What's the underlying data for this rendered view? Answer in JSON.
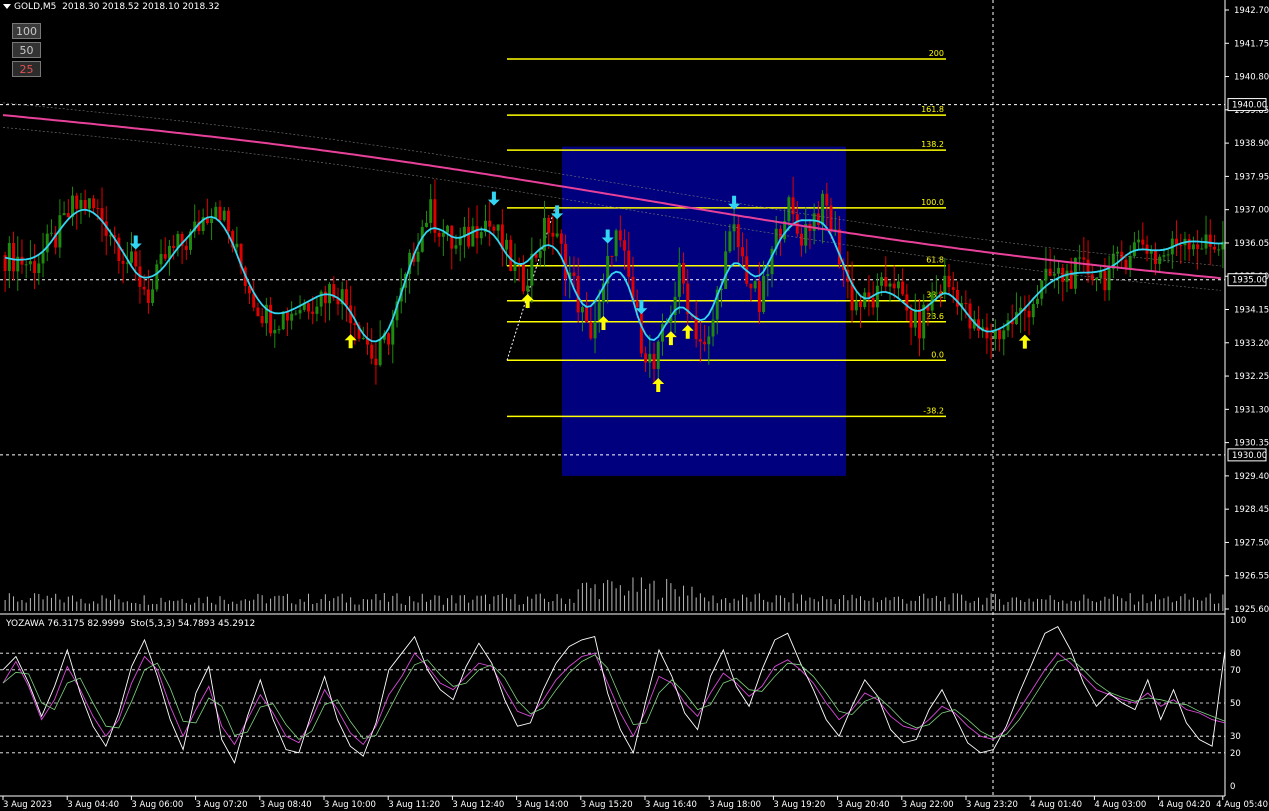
{
  "header": {
    "symbol": "GOLD,M5",
    "ohlc": "2018.30 2018.52 2018.10 2018.32",
    "buttons": [
      "100",
      "50",
      "25"
    ]
  },
  "indicator": {
    "label": "YOZAWA 76.3175 82.9999",
    "stoch_label": "Sto(5,3,3) 54.7893 45.2912"
  },
  "colors": {
    "background": "#000000",
    "bull": "#1f8a0e",
    "bear": "#e00000",
    "ma_fast": "#33d6f2",
    "ma_slow": "#e8419a",
    "fib": "#ffff00",
    "zone": "#00007f",
    "arrow_up": "#ffff00",
    "arrow_down": "#33d6f2"
  },
  "chart_data": [
    {
      "type": "candlestick",
      "title": "",
      "ylim": [
        1925.6,
        1942.7
      ],
      "y_ticks": [
        "1942.70",
        "1941.75",
        "1940.80",
        "1939.85",
        "1938.90",
        "1937.95",
        "1937.00",
        "1936.05",
        "1935.10",
        "1934.15",
        "1933.20",
        "1932.25",
        "1931.30",
        "1930.35",
        "1929.40",
        "1928.45",
        "1927.50",
        "1926.55",
        "1925.60"
      ],
      "x_labels": [
        "3 Aug 2023",
        "3 Aug 04:40",
        "3 Aug 06:00",
        "3 Aug 07:20",
        "3 Aug 08:40",
        "3 Aug 10:00",
        "3 Aug 11:20",
        "3 Aug 12:40",
        "3 Aug 14:00",
        "3 Aug 15:20",
        "3 Aug 16:40",
        "3 Aug 18:00",
        "3 Aug 19:20",
        "3 Aug 20:40",
        "3 Aug 22:00",
        "3 Aug 23:20",
        "4 Aug 01:40",
        "4 Aug 03:00",
        "4 Aug 04:20",
        "4 Aug 05:40"
      ],
      "highlighted_levels": [
        "1940.00",
        "1935.00",
        "1930.00"
      ],
      "closes": [
        1935.7,
        1935.6,
        1935.4,
        1935.8,
        1936.3,
        1937.0,
        1937.2,
        1936.9,
        1936.4,
        1935.7,
        1935.1,
        1934.5,
        1935.6,
        1935.9,
        1936.2,
        1936.8,
        1937.3,
        1936.2,
        1935.2,
        1934.3,
        1933.9,
        1934.0,
        1934.2,
        1934.4,
        1934.6,
        1934.8,
        1934.2,
        1933.5,
        1932.6,
        1933.5,
        1934.6,
        1936.0,
        1937.0,
        1936.4,
        1935.9,
        1936.2,
        1936.8,
        1936.4,
        1935.6,
        1934.9,
        1935.7,
        1936.6,
        1935.8,
        1934.8,
        1933.4,
        1934.2,
        1936.4,
        1935.2,
        1933.4,
        1932.4,
        1933.8,
        1935.2,
        1933.8,
        1932.8,
        1935.0,
        1936.4,
        1935.2,
        1934.2,
        1935.8,
        1937.2,
        1936.2,
        1936.8,
        1937.1,
        1935.8,
        1934.4,
        1934.3,
        1934.5,
        1935.2,
        1934.1,
        1933.6,
        1934.5,
        1934.9,
        1934.6,
        1933.6,
        1933.4,
        1933.5,
        1933.8,
        1934.1,
        1934.6,
        1935.1,
        1935.1,
        1935.2,
        1935.3,
        1935.1,
        1935.4,
        1935.9,
        1936.1,
        1935.6,
        1935.8,
        1936.3,
        1936.1,
        1935.9,
        1936.2
      ],
      "fib_levels": [
        {
          "label": "200",
          "value": 1941.3
        },
        {
          "label": "161.8",
          "value": 1939.7
        },
        {
          "label": "138.2",
          "value": 1938.7
        },
        {
          "label": "100.0",
          "value": 1937.05
        },
        {
          "label": "61.8",
          "value": 1935.4
        },
        {
          "label": "38.2",
          "value": 1934.4
        },
        {
          "label": "23.6",
          "value": 1933.8
        },
        {
          "label": "0.0",
          "value": 1932.7
        },
        {
          "label": "-38.2",
          "value": 1931.1
        }
      ],
      "zone": {
        "from": "3 Aug 14:40",
        "to": "3 Aug 20:00",
        "high": 1938.8,
        "low": 1929.4
      },
      "volume_axis": "volume histogram without scale"
    },
    {
      "type": "line",
      "title": "YOZAWA 76.3175 82.9999 Sto(5,3,3) 54.7893 45.2912",
      "ylim": [
        0,
        100
      ],
      "y_ticks": [
        "100",
        "80",
        "70",
        "50",
        "30",
        "20",
        "0"
      ],
      "reference_levels": [
        80,
        70,
        50,
        30,
        20
      ],
      "series": [
        {
          "name": "Sto(5,3,3)",
          "values": [
            62,
            75,
            60,
            40,
            52,
            72,
            58,
            42,
            30,
            40,
            62,
            78,
            70,
            48,
            30,
            46,
            60,
            36,
            25,
            40,
            55,
            44,
            30,
            26,
            40,
            58,
            46,
            32,
            25,
            36,
            55,
            66,
            80,
            72,
            62,
            58,
            66,
            74,
            72,
            58,
            45,
            42,
            52,
            64,
            72,
            78,
            80,
            62,
            44,
            30,
            46,
            66,
            62,
            50,
            42,
            56,
            68,
            62,
            54,
            60,
            72,
            76,
            70,
            62,
            50,
            40,
            46,
            56,
            52,
            42,
            36,
            34,
            40,
            48,
            44,
            36,
            30,
            28,
            34,
            46,
            58,
            70,
            80,
            74,
            66,
            58,
            55,
            52,
            50,
            56,
            48,
            52,
            46,
            44,
            40,
            38
          ]
        },
        {
          "name": "YOZAWA",
          "values": [
            70,
            78,
            62,
            42,
            60,
            82,
            56,
            36,
            24,
            44,
            72,
            88,
            66,
            40,
            22,
            56,
            72,
            28,
            14,
            42,
            64,
            40,
            22,
            20,
            44,
            66,
            40,
            24,
            18,
            38,
            70,
            80,
            90,
            70,
            58,
            52,
            72,
            86,
            74,
            52,
            36,
            38,
            58,
            74,
            84,
            88,
            90,
            56,
            34,
            20,
            52,
            82,
            66,
            44,
            34,
            66,
            82,
            60,
            48,
            70,
            88,
            92,
            74,
            58,
            40,
            30,
            48,
            64,
            54,
            34,
            26,
            28,
            46,
            58,
            42,
            26,
            20,
            22,
            36,
            56,
            74,
            92,
            96,
            82,
            62,
            48,
            56,
            50,
            46,
            64,
            40,
            58,
            38,
            28,
            24,
            82
          ]
        }
      ]
    }
  ]
}
